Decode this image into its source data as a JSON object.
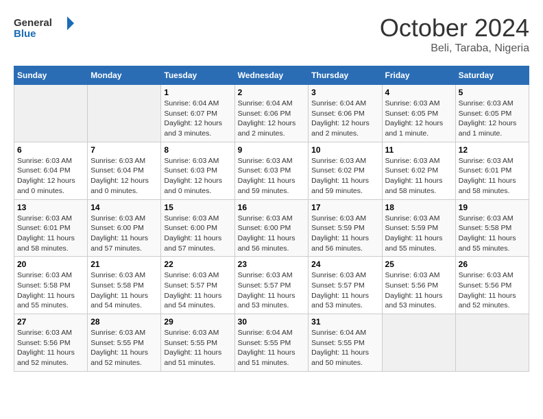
{
  "header": {
    "logo_line1": "General",
    "logo_line2": "Blue",
    "month": "October 2024",
    "location": "Beli, Taraba, Nigeria"
  },
  "columns": [
    "Sunday",
    "Monday",
    "Tuesday",
    "Wednesday",
    "Thursday",
    "Friday",
    "Saturday"
  ],
  "weeks": [
    [
      {
        "num": "",
        "info": ""
      },
      {
        "num": "",
        "info": ""
      },
      {
        "num": "1",
        "info": "Sunrise: 6:04 AM\nSunset: 6:07 PM\nDaylight: 12 hours and 3 minutes."
      },
      {
        "num": "2",
        "info": "Sunrise: 6:04 AM\nSunset: 6:06 PM\nDaylight: 12 hours and 2 minutes."
      },
      {
        "num": "3",
        "info": "Sunrise: 6:04 AM\nSunset: 6:06 PM\nDaylight: 12 hours and 2 minutes."
      },
      {
        "num": "4",
        "info": "Sunrise: 6:03 AM\nSunset: 6:05 PM\nDaylight: 12 hours and 1 minute."
      },
      {
        "num": "5",
        "info": "Sunrise: 6:03 AM\nSunset: 6:05 PM\nDaylight: 12 hours and 1 minute."
      }
    ],
    [
      {
        "num": "6",
        "info": "Sunrise: 6:03 AM\nSunset: 6:04 PM\nDaylight: 12 hours and 0 minutes."
      },
      {
        "num": "7",
        "info": "Sunrise: 6:03 AM\nSunset: 6:04 PM\nDaylight: 12 hours and 0 minutes."
      },
      {
        "num": "8",
        "info": "Sunrise: 6:03 AM\nSunset: 6:03 PM\nDaylight: 12 hours and 0 minutes."
      },
      {
        "num": "9",
        "info": "Sunrise: 6:03 AM\nSunset: 6:03 PM\nDaylight: 11 hours and 59 minutes."
      },
      {
        "num": "10",
        "info": "Sunrise: 6:03 AM\nSunset: 6:02 PM\nDaylight: 11 hours and 59 minutes."
      },
      {
        "num": "11",
        "info": "Sunrise: 6:03 AM\nSunset: 6:02 PM\nDaylight: 11 hours and 58 minutes."
      },
      {
        "num": "12",
        "info": "Sunrise: 6:03 AM\nSunset: 6:01 PM\nDaylight: 11 hours and 58 minutes."
      }
    ],
    [
      {
        "num": "13",
        "info": "Sunrise: 6:03 AM\nSunset: 6:01 PM\nDaylight: 11 hours and 58 minutes."
      },
      {
        "num": "14",
        "info": "Sunrise: 6:03 AM\nSunset: 6:00 PM\nDaylight: 11 hours and 57 minutes."
      },
      {
        "num": "15",
        "info": "Sunrise: 6:03 AM\nSunset: 6:00 PM\nDaylight: 11 hours and 57 minutes."
      },
      {
        "num": "16",
        "info": "Sunrise: 6:03 AM\nSunset: 6:00 PM\nDaylight: 11 hours and 56 minutes."
      },
      {
        "num": "17",
        "info": "Sunrise: 6:03 AM\nSunset: 5:59 PM\nDaylight: 11 hours and 56 minutes."
      },
      {
        "num": "18",
        "info": "Sunrise: 6:03 AM\nSunset: 5:59 PM\nDaylight: 11 hours and 55 minutes."
      },
      {
        "num": "19",
        "info": "Sunrise: 6:03 AM\nSunset: 5:58 PM\nDaylight: 11 hours and 55 minutes."
      }
    ],
    [
      {
        "num": "20",
        "info": "Sunrise: 6:03 AM\nSunset: 5:58 PM\nDaylight: 11 hours and 55 minutes."
      },
      {
        "num": "21",
        "info": "Sunrise: 6:03 AM\nSunset: 5:58 PM\nDaylight: 11 hours and 54 minutes."
      },
      {
        "num": "22",
        "info": "Sunrise: 6:03 AM\nSunset: 5:57 PM\nDaylight: 11 hours and 54 minutes."
      },
      {
        "num": "23",
        "info": "Sunrise: 6:03 AM\nSunset: 5:57 PM\nDaylight: 11 hours and 53 minutes."
      },
      {
        "num": "24",
        "info": "Sunrise: 6:03 AM\nSunset: 5:57 PM\nDaylight: 11 hours and 53 minutes."
      },
      {
        "num": "25",
        "info": "Sunrise: 6:03 AM\nSunset: 5:56 PM\nDaylight: 11 hours and 53 minutes."
      },
      {
        "num": "26",
        "info": "Sunrise: 6:03 AM\nSunset: 5:56 PM\nDaylight: 11 hours and 52 minutes."
      }
    ],
    [
      {
        "num": "27",
        "info": "Sunrise: 6:03 AM\nSunset: 5:56 PM\nDaylight: 11 hours and 52 minutes."
      },
      {
        "num": "28",
        "info": "Sunrise: 6:03 AM\nSunset: 5:55 PM\nDaylight: 11 hours and 52 minutes."
      },
      {
        "num": "29",
        "info": "Sunrise: 6:03 AM\nSunset: 5:55 PM\nDaylight: 11 hours and 51 minutes."
      },
      {
        "num": "30",
        "info": "Sunrise: 6:04 AM\nSunset: 5:55 PM\nDaylight: 11 hours and 51 minutes."
      },
      {
        "num": "31",
        "info": "Sunrise: 6:04 AM\nSunset: 5:55 PM\nDaylight: 11 hours and 50 minutes."
      },
      {
        "num": "",
        "info": ""
      },
      {
        "num": "",
        "info": ""
      }
    ]
  ]
}
